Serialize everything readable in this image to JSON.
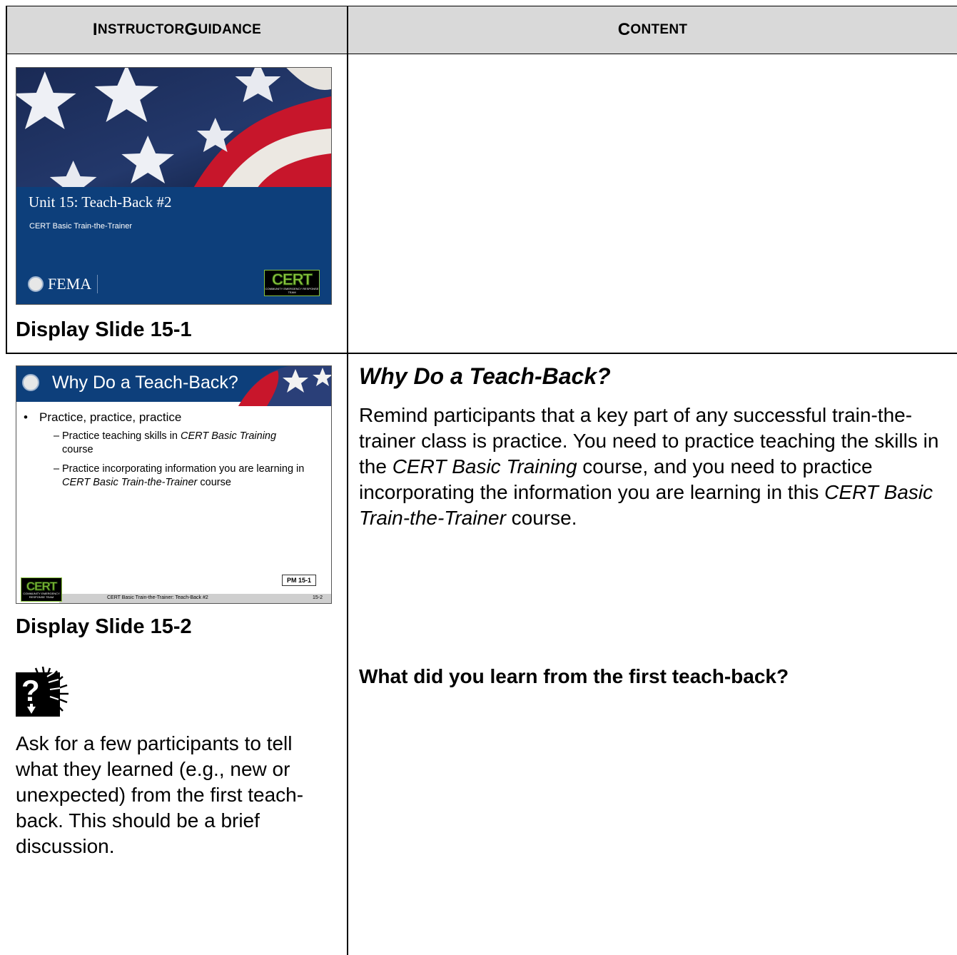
{
  "table": {
    "header_left": {
      "first": "I",
      "rest": "NSTRUCTOR ",
      "first2": "G",
      "rest2": "UIDANCE"
    },
    "header_right": {
      "first": "C",
      "rest": "ONTENT"
    }
  },
  "slide1": {
    "title": "Unit 15: Teach-Back #2",
    "subtitle": "CERT Basic Train-the-Trainer",
    "fema_text": "FEMA",
    "cert_logo": "CERT",
    "cert_logo_sub": "COMMUNITY EMERGENCY RESPONSE TEAM",
    "caption": "Display Slide 15-1"
  },
  "slide2": {
    "title": "Why Do a Teach-Back?",
    "bullet": "Practice, practice, practice",
    "sub1_a": "Practice teaching skills in ",
    "sub1_b": "CERT Basic Training",
    "sub1_c": " course",
    "sub2_a": "Practice incorporating information you are learning in ",
    "sub2_b": "CERT Basic Train-the-Trainer",
    "sub2_c": " course",
    "pm_label": "PM 15-1",
    "footer": "CERT Basic Train-the-Trainer: Teach-Back #2",
    "page": "15-2",
    "cert_logo": "CERT",
    "cert_logo_sub": "COMMUNITY EMERGENCY RESPONSE TEAM",
    "caption": "Display Slide 15-2"
  },
  "guidance": {
    "icon": "question-discussion-icon",
    "text": "Ask for a few participants to tell what they learned (e.g., new or unexpected) from the first teach-back. This should be a brief discussion."
  },
  "content": {
    "heading": "Why Do a Teach-Back?",
    "para_a": "Remind participants that a key part of any successful train-the-trainer class is practice. You need to practice teaching the skills in the ",
    "para_b": "CERT Basic Training",
    "para_c": " course, and you need to practice incorporating the information you are learning in this ",
    "para_d": "CERT Basic Train-the-Trainer",
    "para_e": " course.",
    "question": "What did you learn from the first teach-back?"
  },
  "colors": {
    "header_bg": "#d9d9d9",
    "slide_blue": "#0d3f7b",
    "cert_green": "#8bc53f"
  }
}
